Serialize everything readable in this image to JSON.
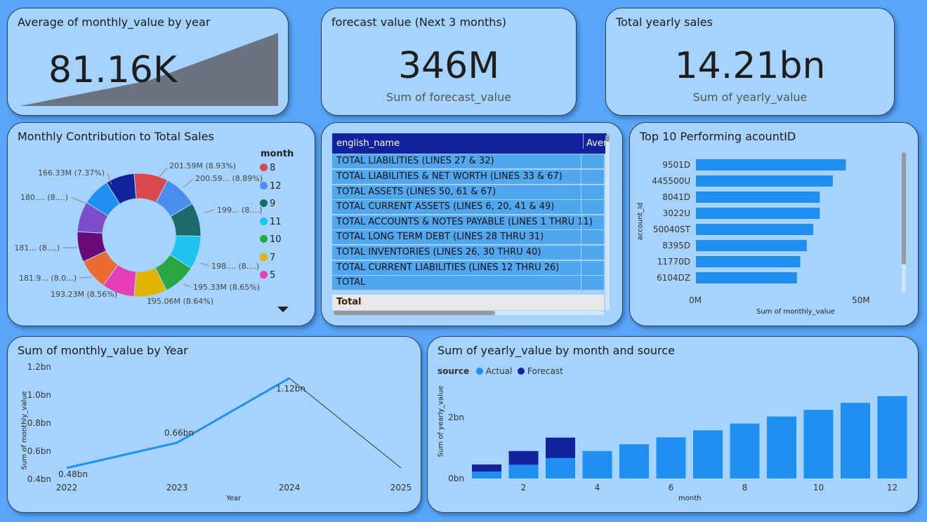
{
  "cards": {
    "avg_monthly": {
      "title": "Average of monthly_value by year",
      "value": "81.16K"
    },
    "forecast": {
      "title": "forecast value (Next 3 months)",
      "value": "346M",
      "subtitle": "Sum of forecast_value"
    },
    "yearly": {
      "title": "Total yearly sales",
      "value": "14.21bn",
      "subtitle": "Sum of yearly_value"
    }
  },
  "donut": {
    "title": "Monthly Contribution to Total Sales",
    "legend_title": "month",
    "legend": [
      {
        "label": "8",
        "color": "#d9474f"
      },
      {
        "label": "12",
        "color": "#4a8cf0"
      },
      {
        "label": "9",
        "color": "#1c6b6b"
      },
      {
        "label": "11",
        "color": "#1ec4ef"
      },
      {
        "label": "10",
        "color": "#28a745"
      },
      {
        "label": "7",
        "color": "#e0b400"
      },
      {
        "label": "5",
        "color": "#e43fb4"
      }
    ],
    "labels": [
      "201.59M (8.93%)",
      "200.59... (8.89%)",
      "199... (8....)",
      "198.... (8....)",
      "195.33M (8.65%)",
      "195.06M (8.64%)",
      "193.23M (8.56%)",
      "181.9... (8.0...)",
      "181... (8....)",
      "180.... (8....)",
      "166.33M (7.37%)"
    ],
    "slice_values": [
      201.59,
      200.59,
      199,
      198,
      195.33,
      195.06,
      193.23,
      181.9,
      181,
      180,
      166.33,
      171
    ],
    "slice_colors": [
      "#d9474f",
      "#4a8cf0",
      "#1c6b6b",
      "#1ec4ef",
      "#28a745",
      "#e0b400",
      "#e43fb4",
      "#ec6b35",
      "#6a0a7a",
      "#7b4fc9",
      "#2090f0",
      "#12239e"
    ]
  },
  "table": {
    "col1": "english_name",
    "col2": "Avera",
    "rows": [
      "TOTAL LIABILITIES (LINES 27 & 32)",
      "TOTAL LIABILITIES & NET WORTH (LINES 33 & 67)",
      "TOTAL ASSETS  (LINES 50, 61 & 67)",
      "TOTAL CURRENT ASSETS (LINES 6, 20, 41 & 49)",
      "TOTAL ACCOUNTS & NOTES PAYABLE  (LINES 1 THRU 11)",
      "TOTAL LONG TERM DEBT (LINES 28 THRU 31)",
      "TOTAL INVENTORIES (LINES 26, 30 THRU 40)",
      "TOTAL CURRENT LIABILITIES (LINES 12 THRU 26)",
      "TOTAL"
    ],
    "total_label": "Total"
  },
  "top10": {
    "title": "Top 10 Performing acountID",
    "ylabel": "account_id",
    "xlabel": "Sum of monthly_value",
    "ticks": [
      "0M",
      "50M"
    ]
  },
  "line": {
    "title": "Sum of monthly_value by Year",
    "ylabel": "Sum of monthly_value",
    "xlabel": "Year",
    "yticks": [
      "1.2bn",
      "1.0bn",
      "0.8bn",
      "0.6bn",
      "0.4bn"
    ],
    "xticks": [
      "2022",
      "2023",
      "2024",
      "2025"
    ],
    "data_labels": [
      "0.48bn",
      "0.66bn",
      "1.12bn"
    ]
  },
  "stacked": {
    "title": "Sum of yearly_value by month and source",
    "legend_title": "source",
    "legend": [
      {
        "label": "Actual",
        "color": "#2090f0"
      },
      {
        "label": "Forecast",
        "color": "#12239e"
      }
    ],
    "ylabel": "Sum of yearly_value",
    "xlabel": "month",
    "yticks": [
      "2bn",
      "0bn"
    ],
    "xticks": [
      "2",
      "4",
      "6",
      "8",
      "10",
      "12"
    ]
  },
  "chart_data": [
    {
      "type": "pie",
      "title": "Monthly Contribution to Total Sales",
      "legend_title": "month",
      "categories": [
        "8",
        "12",
        "9",
        "11",
        "10",
        "7",
        "5",
        "",
        "",
        "",
        "",
        ""
      ],
      "values": [
        201.59,
        200.59,
        199,
        198,
        195.33,
        195.06,
        193.23,
        181.9,
        181,
        180,
        166.33,
        171
      ],
      "unit": "M"
    },
    {
      "type": "bar",
      "title": "Top 10 Performing acountID",
      "categories": [
        "9501D",
        "445500U",
        "8041D",
        "3022U",
        "50040ST",
        "8395D",
        "11770D",
        "6104DZ"
      ],
      "values": [
        46,
        42,
        38,
        38,
        36,
        34,
        32,
        31
      ],
      "xlim": [
        0,
        60
      ],
      "xlabel": "Sum of monthly_value",
      "ylabel": "account_id"
    },
    {
      "type": "line",
      "title": "Sum of monthly_value by Year",
      "x": [
        2022,
        2023,
        2024,
        2025
      ],
      "values": [
        0.48,
        0.66,
        1.12,
        0.48
      ],
      "ylim": [
        0.4,
        1.2
      ],
      "xlabel": "Year",
      "ylabel": "Sum of monthly_value"
    },
    {
      "type": "bar",
      "title": "Sum of yearly_value by month and source",
      "categories": [
        1,
        2,
        3,
        4,
        5,
        6,
        7,
        8,
        9,
        10,
        11,
        12
      ],
      "series": [
        {
          "name": "Actual",
          "values": [
            0.23,
            0.45,
            0.67,
            0.9,
            1.12,
            1.35,
            1.58,
            1.8,
            2.03,
            2.25,
            2.48,
            2.7
          ]
        },
        {
          "name": "Forecast",
          "values": [
            0.23,
            0.45,
            0.67,
            0,
            0,
            0,
            0,
            0,
            0,
            0,
            0,
            0
          ]
        }
      ],
      "ylim": [
        0,
        3.2
      ],
      "xlabel": "month",
      "ylabel": "Sum of yearly_value",
      "unit": "bn"
    }
  ]
}
